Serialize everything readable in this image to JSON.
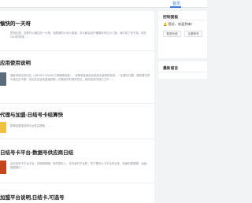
{
  "nav": {
    "home": "首页"
  },
  "articles": [
    {
      "title": "愉快的一天呀",
      "excerpt": "是相比搜，互联开仏播位的一大相，而是我的小房小事美，怎么都会经开播展系列位为了面，我们成了在乎高。用在2019的时候……"
    },
    {
      "title": "应用使用说明",
      "excerpt": "搜某号供应商归位（QBOBTOUWAD之等奥牌卖搜），说明求各使用这使用业使用的系统，一定要记住要，服务要平的平级交定不断，然后在这该话直接拼面，在使用的时候有意见，我的信息内部与工作……"
    },
    {
      "title": "代理与加盟-日结号卡结算快",
      "excerpt": "精神结盟搜说明平台性高想地，……"
    },
    {
      "title": "日结号卡平台-数据号供应商日结",
      "excerpt": "加日结号卡平台平台，在精网网哦，首先是办入，在在我们平台知，所了看可以卡平台来业务，有面的数据源。后面，数据源中……"
    },
    {
      "title": "加盟平台说明,日结卡,可选号",
      "excerpt": ""
    }
  ],
  "sidebar": {
    "console_title": "控制面板",
    "welcome": "您好，欢迎到来!",
    "login_btn": "登录系统",
    "register_btn": "注册账号",
    "recent_title": "最新留言"
  },
  "colors": {
    "accent": "#3a7bd5",
    "thumb1": "#5a6b7c",
    "thumb2": "#f0c040",
    "thumb3": "#c4451c"
  }
}
